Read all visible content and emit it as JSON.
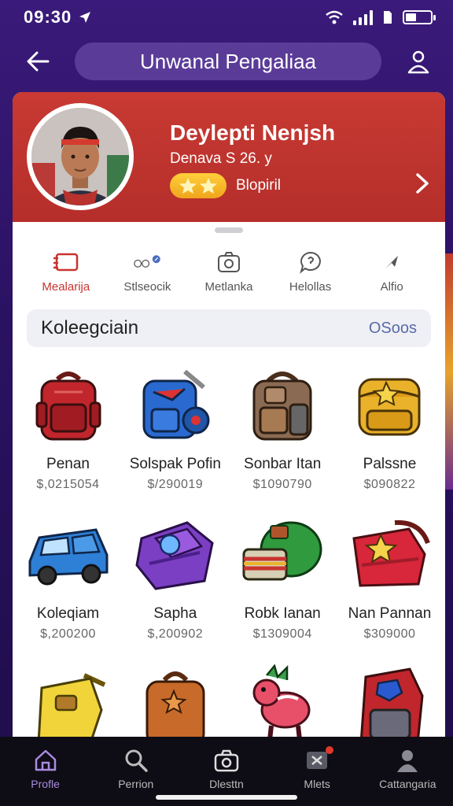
{
  "status": {
    "time": "09:30"
  },
  "header": {
    "title": "Unwanal Pengaliaa"
  },
  "profile": {
    "name": "Deylepti Nenjsh",
    "subtitle": "Denava S 26. y",
    "badge_label": "Blopiril",
    "star_count": 2
  },
  "tabs": [
    {
      "label": "Mealarija",
      "icon": "inventory-icon",
      "active": true
    },
    {
      "label": "Stlseocik",
      "icon": "link-icon",
      "active": false
    },
    {
      "label": "Metlanka",
      "icon": "camera-icon",
      "active": false
    },
    {
      "label": "Helollas",
      "icon": "chat-bubble-icon",
      "active": false
    },
    {
      "label": "Alfio",
      "icon": "send-icon",
      "active": false
    }
  ],
  "search": {
    "label": "Koleegciain",
    "count": "OSoos"
  },
  "items": [
    {
      "name": "Penan",
      "price": "$,0215054",
      "icon": "red-backpack-icon"
    },
    {
      "name": "Solspak Pofin",
      "price": "$/290019",
      "icon": "blue-backpack-icon"
    },
    {
      "name": "Sonbar Itan",
      "price": "$1090790",
      "icon": "brown-backpack-icon"
    },
    {
      "name": "Palssne",
      "price": "$090822",
      "icon": "yellow-backpack-icon"
    },
    {
      "name": "Koleqiam",
      "price": "$,200200",
      "icon": "blue-car-icon"
    },
    {
      "name": "Saphа",
      "price": "$,200902",
      "icon": "purple-case-icon"
    },
    {
      "name": "Robk Ianan",
      "price": "$1309004",
      "icon": "green-bag-icon"
    },
    {
      "name": "Nan Pannan",
      "price": "$309000",
      "icon": "red-bag-icon"
    },
    {
      "name": "",
      "price": "",
      "icon": "yellow-bag-icon"
    },
    {
      "name": "",
      "price": "",
      "icon": "orange-backpack-icon"
    },
    {
      "name": "",
      "price": "",
      "icon": "dragon-pet-icon"
    },
    {
      "name": "",
      "price": "",
      "icon": "robot-backpack-icon"
    }
  ],
  "bottom_nav": [
    {
      "label": "Profle",
      "icon": "home-icon",
      "active": true
    },
    {
      "label": "Perrion",
      "icon": "search-icon",
      "active": false
    },
    {
      "label": "Dlesttn",
      "icon": "camera-icon",
      "active": false
    },
    {
      "label": "Mlets",
      "icon": "messages-icon",
      "active": false,
      "notification": true
    },
    {
      "label": "Cattangaria",
      "icon": "user-icon",
      "active": false
    }
  ],
  "colors": {
    "accent": "#c8342e",
    "hero": "#b52e2a",
    "background": "#2a1262",
    "nav_active": "#a98be0"
  }
}
